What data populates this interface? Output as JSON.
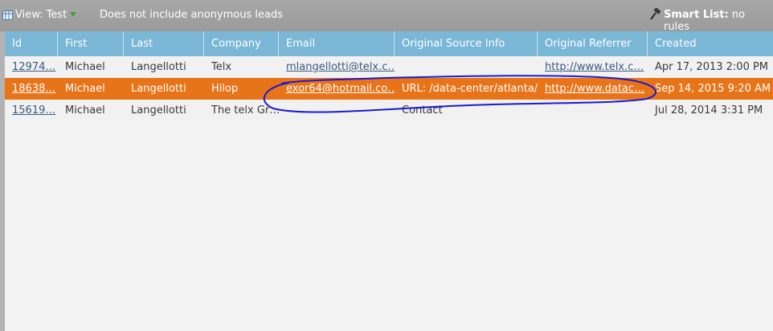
{
  "toolbar": {
    "view_label": "View: Test",
    "anonymous_text": "Does not include anonymous leads",
    "smart_list_label": "Smart List:",
    "smart_list_value": "no rules",
    "view_icon": "list-view-icon",
    "smart_list_icon": "gavel-icon",
    "caret_color": "#3fa12b"
  },
  "columns": [
    "Id",
    "First",
    "Last",
    "Company",
    "Email",
    "Original Source Info",
    "Original Referrer",
    "Created"
  ],
  "rows": [
    {
      "id": "12974…",
      "first": "Michael",
      "last": "Langellotti",
      "company": "Telx",
      "email": "mlangellotti@telx.c…",
      "source": "",
      "referrer": "http://www.telx.c…",
      "created": "Apr 17, 2013 2:00 PM"
    },
    {
      "id": "18638…",
      "first": "Michael",
      "last": "Langellotti",
      "company": "Hilop",
      "email": "exor64@hotmail.co…",
      "source": "URL: /data-center/atlanta/",
      "referrer": "http://www.datac…",
      "created": "Sep 14, 2015 9:20 AM"
    },
    {
      "id": "15619…",
      "first": "Michael",
      "last": "Langellotti",
      "company": "The telx Gr…",
      "email": "",
      "source": "Contact",
      "referrer": "",
      "created": "Jul 28, 2014 3:31 PM"
    }
  ],
  "colors": {
    "header": "#7ab6d6",
    "selected_row": "#e8741a",
    "toolbar": "#a0a0a0",
    "annotation_stroke": "#1a1ad0"
  }
}
